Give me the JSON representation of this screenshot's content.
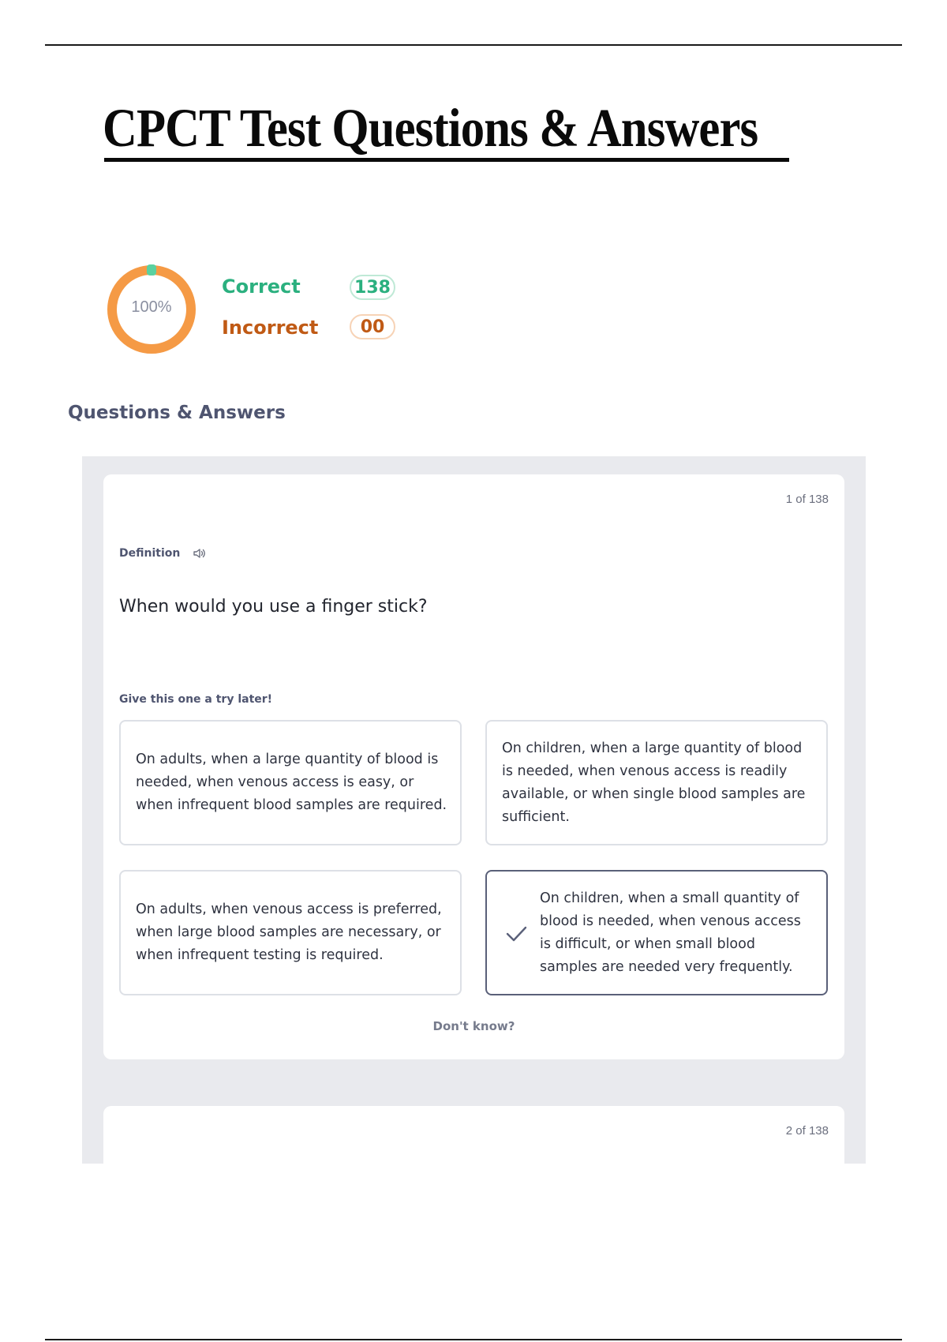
{
  "document": {
    "title": "CPCT Test Questions & Answers"
  },
  "score": {
    "percent_label": "100%",
    "percent_value": 100,
    "correct_label": "Correct",
    "correct_count": "138",
    "incorrect_label": "Incorrect",
    "incorrect_count": "00",
    "colors": {
      "correct": "#2bb07f",
      "incorrect": "#c05a15",
      "ring": "#f59a45",
      "ring_marker": "#5ad1a0"
    }
  },
  "section": {
    "heading": "Questions & Answers"
  },
  "cards": [
    {
      "counter": "1 of 138",
      "term_label": "Definition",
      "question": "When would you use a finger stick?",
      "hint": "Give this one a try later!",
      "options": [
        {
          "text": "On adults, when a large quantity of blood is needed, when venous access is easy, or when infrequent blood samples are required.",
          "selected": false
        },
        {
          "text": "On children, when a large quantity of blood is needed, when venous access is readily available, or when single blood samples are sufficient.",
          "selected": false
        },
        {
          "text": "On adults, when venous access is preferred, when large blood samples are necessary, or when infrequent testing is required.",
          "selected": false
        },
        {
          "text": "On children, when a small quantity of blood is needed, when venous access is difficult, or when small blood samples are needed very frequently.",
          "selected": true
        }
      ],
      "dont_know": "Don't know?"
    },
    {
      "counter": "2 of 138"
    }
  ]
}
